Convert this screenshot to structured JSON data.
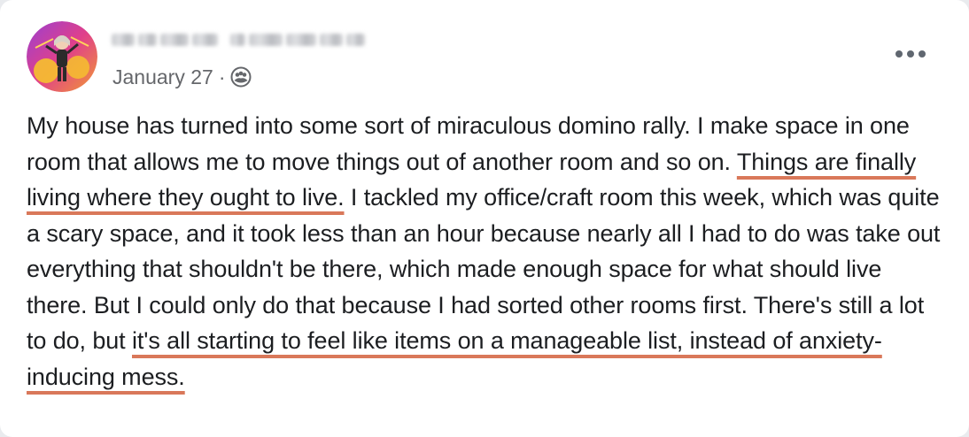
{
  "post": {
    "date": "January 27",
    "separator": "·",
    "audience_icon": "friends-group-icon",
    "more_icon": "ellipsis-horizontal-icon",
    "author_avatar": "bitmoji-avatar",
    "author_name_redacted": true,
    "body": {
      "part1": "My house has turned into some sort of miraculous domino rally. I make space in one room that allows me to move things out of another room and so on. ",
      "highlight1": "Things are finally living where they ought to live.",
      "part2": " I tackled my office/craft room this week, which was quite a scary space, and it took less than an hour because nearly all I had to do was take out everything that shouldn't be there, which made enough space for what should live there. But I could only do that because I had sorted other rooms first. There's still a lot to do, but ",
      "highlight2": "it's all starting to feel like items on a manageable list, instead of anxiety-inducing mess."
    }
  },
  "colors": {
    "text": "#1c1e21",
    "meta": "#65676b",
    "underline": "#d9785a",
    "card": "#ffffff"
  }
}
